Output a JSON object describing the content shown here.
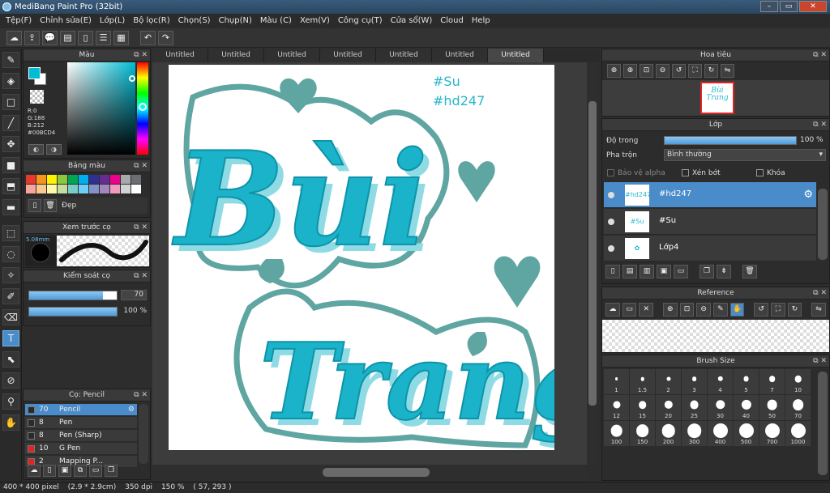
{
  "window": {
    "title": "MediBang Paint Pro (32bit)",
    "controls": [
      "–",
      "▭",
      "✕"
    ]
  },
  "menu": [
    "Tệp(F)",
    "Chỉnh sửa(E)",
    "Lớp(L)",
    "Bộ lọc(R)",
    "Chọn(S)",
    "Chụp(N)",
    "Màu (C)",
    "Xem(V)",
    "Công cụ(T)",
    "Cửa sổ(W)",
    "Cloud",
    "Help"
  ],
  "toolbar": {
    "icons": [
      "cloud-icon",
      "upload-icon",
      "chat-icon",
      "comment-icon",
      "page-icon",
      "list-icon",
      "grid-icon",
      "undo-icon",
      "redo-icon"
    ],
    "glyphs": [
      "☁",
      "⇪",
      "💬",
      "▤",
      "▯",
      "☰",
      "▦",
      "↶",
      "↷"
    ]
  },
  "tools": [
    {
      "name": "brush",
      "glyph": "✎"
    },
    {
      "name": "eraser",
      "glyph": "◈"
    },
    {
      "name": "rectangle",
      "glyph": "□"
    },
    {
      "name": "line",
      "glyph": "╱"
    },
    {
      "name": "move",
      "glyph": "✥"
    },
    {
      "name": "fill-shape",
      "glyph": "■"
    },
    {
      "name": "bucket",
      "glyph": "⬒"
    },
    {
      "name": "gradient",
      "glyph": "▬"
    },
    {
      "name": "select",
      "glyph": "⬚"
    },
    {
      "name": "lasso",
      "glyph": "◌"
    },
    {
      "name": "magic-wand",
      "glyph": "✧"
    },
    {
      "name": "select-pen",
      "glyph": "✐"
    },
    {
      "name": "select-eraser",
      "glyph": "⌫"
    },
    {
      "name": "text",
      "glyph": "T"
    },
    {
      "name": "operation",
      "glyph": "⬉"
    },
    {
      "name": "dropper",
      "glyph": "⊘"
    },
    {
      "name": "pipette",
      "glyph": "⚲"
    },
    {
      "name": "hand",
      "glyph": "✋"
    }
  ],
  "color_panel": {
    "title": "Màu",
    "r": "R:0",
    "g": "G:188",
    "b": "B:212",
    "hex": "#00BCD4",
    "current_color": "#00bcd4"
  },
  "palette_panel": {
    "title": "Bảng màu",
    "colors": [
      "#e8382d",
      "#f7941d",
      "#fff200",
      "#8dc63f",
      "#00a651",
      "#00aeef",
      "#2e3192",
      "#662d91",
      "#ec008c",
      "#a7a9ac",
      "#6d6e71",
      "#f9a69a",
      "#fbc990",
      "#fff8a6",
      "#c4df9b",
      "#7accc8",
      "#6dcff6",
      "#8393ca",
      "#a187be",
      "#f49ac1",
      "#d1d3d4",
      "#ffffff"
    ],
    "palette_name": "Đẹp"
  },
  "preview_panel": {
    "title": "Xem trước cọ",
    "size": "5.08mm"
  },
  "brush_control": {
    "title": "Kiểm soát cọ",
    "size": 70,
    "size_value": "70",
    "opacity_value": "100 %"
  },
  "brush_list": {
    "title": "Cọ: Pencil",
    "items": [
      {
        "size": "70",
        "name": "Pencil",
        "color": "#2a2a2a",
        "selected": true
      },
      {
        "size": "8",
        "name": "Pen",
        "color": "#2a2a2a",
        "selected": false
      },
      {
        "size": "8",
        "name": "Pen (Sharp)",
        "color": "#2a2a2a",
        "selected": false
      },
      {
        "size": "10",
        "name": "G Pen",
        "color": "#e02424",
        "selected": false
      },
      {
        "size": "2",
        "name": "Mapping P...",
        "color": "#e02424",
        "selected": false
      }
    ]
  },
  "tabs": [
    "Untitled",
    "Untitled",
    "Untitled",
    "Untitled",
    "Untitled",
    "Untitled",
    "Untitled"
  ],
  "canvas": {
    "tag1": "#Su",
    "tag2": "#hd247",
    "word1": "Bùi",
    "word2": "Trang"
  },
  "navigator": {
    "title": "Hoa tiêu",
    "thumb_text": "Bùi Trang"
  },
  "layer_panel": {
    "title": "Lớp",
    "opacity_label": "Độ trong",
    "opacity_value": "100 %",
    "blend_label": "Pha trộn",
    "blend_value": "Bình thường",
    "protect_alpha": "Bảo vệ alpha",
    "clip": "Xén bớt",
    "lock": "Khóa",
    "layers": [
      {
        "name": "#hd247",
        "thumb": "#hd247",
        "selected": true
      },
      {
        "name": "#Su",
        "thumb": "#Su",
        "selected": false
      },
      {
        "name": "Lớp4",
        "thumb": "✿",
        "selected": false
      }
    ]
  },
  "reference_panel": {
    "title": "Reference"
  },
  "brush_size_panel": {
    "title": "Brush Size",
    "sizes": [
      "1",
      "1.5",
      "2",
      "3",
      "4",
      "5",
      "7",
      "10",
      "12",
      "15",
      "20",
      "25",
      "30",
      "40",
      "50",
      "70",
      "100",
      "150",
      "200",
      "300",
      "400",
      "500",
      "700",
      "1000"
    ]
  },
  "status": {
    "dims": "400 * 400 pixel",
    "cm": "(2.9 * 2.9cm)",
    "dpi": "350 dpi",
    "zoom": "150 %",
    "coords": "( 57, 293 )"
  }
}
